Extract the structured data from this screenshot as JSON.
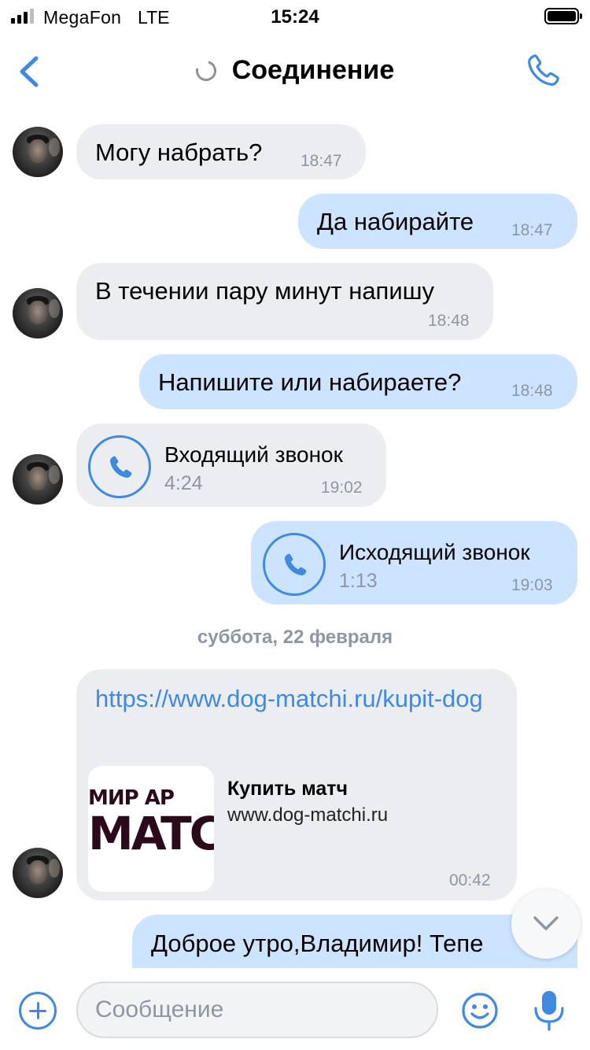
{
  "status_bar": {
    "carrier": "MegaFon",
    "network": "LTE",
    "time": "15:24",
    "signal_bars_filled": 3,
    "signal_bars_total": 4
  },
  "header": {
    "title": "Соединение",
    "back_icon": "chevron-left-icon",
    "call_icon": "phone-icon",
    "status_icon": "loading-spinner-icon"
  },
  "messages": [
    {
      "direction": "incoming",
      "text": "Могу набрать?",
      "time": "18:47"
    },
    {
      "direction": "outgoing",
      "text": "Да набирайте",
      "time": "18:47"
    },
    {
      "direction": "incoming",
      "text": "В течении пару минут напишу",
      "time": "18:48"
    },
    {
      "direction": "outgoing",
      "text": "Напишите или набираете?",
      "time": "18:48"
    },
    {
      "direction": "incoming",
      "type": "call",
      "title": "Входящий звонок",
      "duration": "4:24",
      "time": "19:02"
    },
    {
      "direction": "outgoing",
      "type": "call",
      "title": "Исходящий звонок",
      "duration": "1:13",
      "time": "19:03"
    }
  ],
  "date_separator": "суббота, 22 февраля",
  "link_message": {
    "direction": "incoming",
    "url": "https://www.dog-matchi.ru/kupit-dog",
    "preview_title": "Купить матч",
    "preview_domain": "www.dog-matchi.ru",
    "preview_image_text_1": "МИР АР",
    "preview_image_text_2": "MATCI",
    "time": "00:42"
  },
  "partial_message": {
    "direction": "outgoing",
    "text": "Доброе утро,Владимир! Тепе"
  },
  "composer": {
    "placeholder": "Сообщение"
  },
  "colors": {
    "accent": "#3f8ae0",
    "incoming_bubble": "#ebedf0",
    "outgoing_bubble": "#cce4ff",
    "time_text": "#8d97a3"
  }
}
